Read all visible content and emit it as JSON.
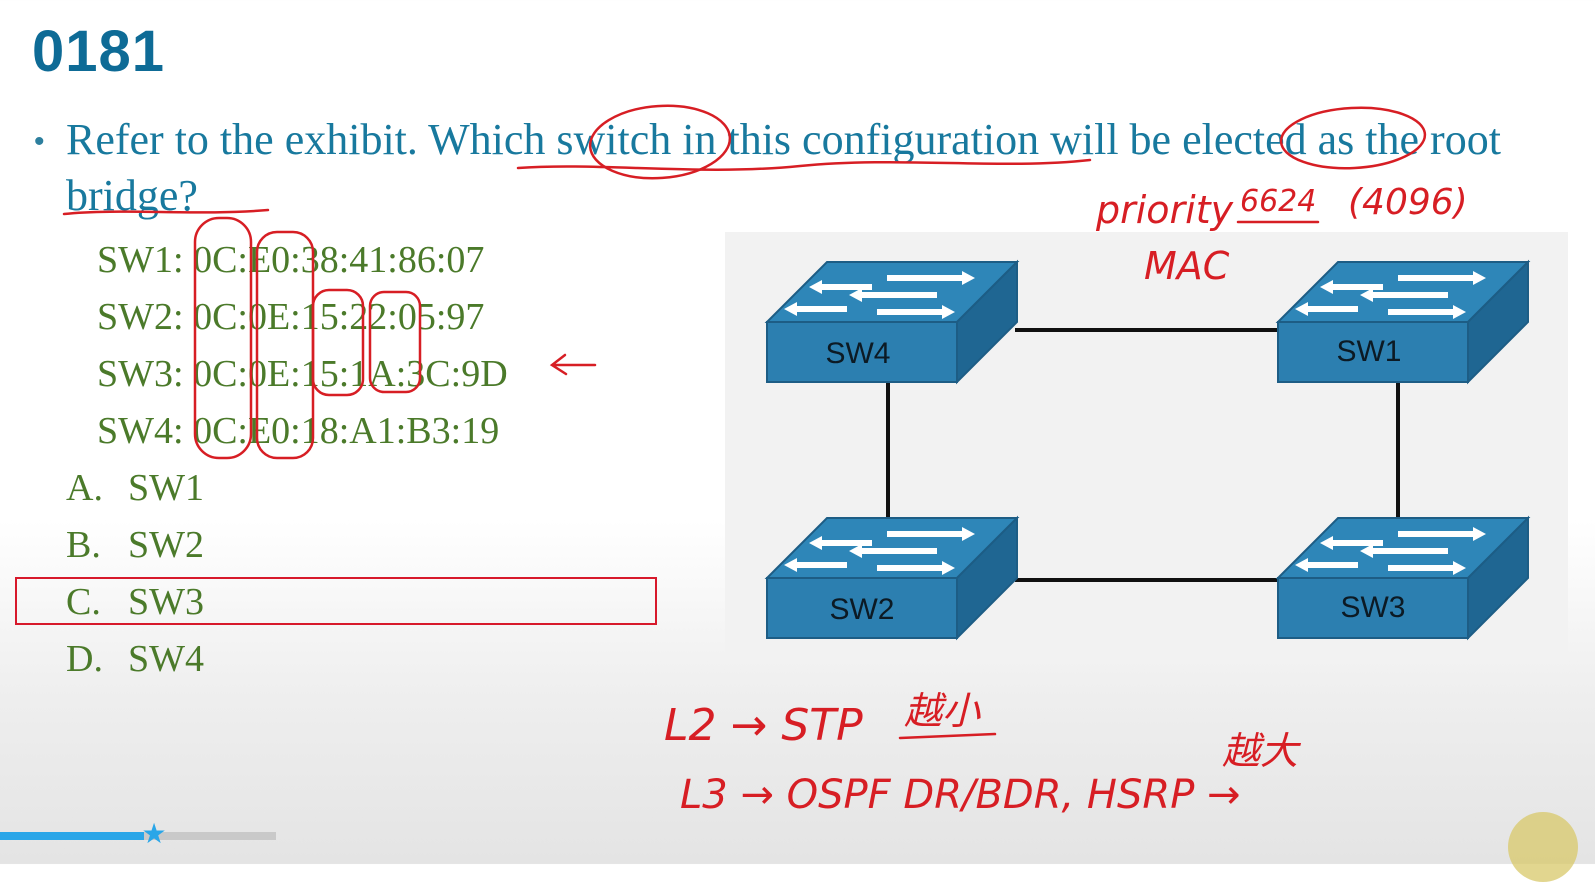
{
  "slide": {
    "number": "0181",
    "question": "Refer to the exhibit. Which switch in this configuration will be elected as the root bridge?",
    "mac_addresses": [
      {
        "label": "SW1:",
        "mac": "0C:E0:38:41:86:07"
      },
      {
        "label": "SW2:",
        "mac": "0C:0E:15:22:05:97"
      },
      {
        "label": "SW3:",
        "mac": "0C:0E:15:1A:3C:9D"
      },
      {
        "label": "SW4:",
        "mac": "0C:E0:18:A1:B3:19"
      }
    ],
    "options": [
      {
        "letter": "A.",
        "text": "SW1"
      },
      {
        "letter": "B.",
        "text": "SW2"
      },
      {
        "letter": "C.",
        "text": "SW3"
      },
      {
        "letter": "D.",
        "text": "SW4"
      }
    ],
    "selected_option": "C"
  },
  "exhibit": {
    "switches": [
      "SW4",
      "SW1",
      "SW2",
      "SW3"
    ]
  },
  "annotations": {
    "priority": "priority",
    "priority_value": "(4096)",
    "mac": "MAC",
    "l2_line": "L2 → STP",
    "l3_line": "L3 → OSPF DR/BDR, HSRP →"
  },
  "player": {
    "progress": 0.09
  },
  "colors": {
    "title": "#0e6b96",
    "question": "#18799e",
    "answers": "#4b7a2a",
    "ink": "#d71e24",
    "switch_blue": "#2c7fb0"
  }
}
